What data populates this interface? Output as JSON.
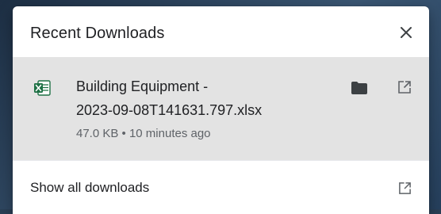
{
  "header": {
    "title": "Recent Downloads",
    "close_icon": "close-icon"
  },
  "downloads": [
    {
      "file_icon": "excel-file-icon",
      "file_name_line1": "Building Equipment -",
      "file_name_line2": "2023-09-08T141631.797.xlsx",
      "meta": "47.0 KB • 10 minutes ago",
      "folder_icon": "folder-icon",
      "open_icon": "open-external-icon"
    }
  ],
  "footer": {
    "label": "Show all downloads",
    "icon": "open-external-icon"
  },
  "colors": {
    "item_background": "#e3e3e3",
    "excel_green": "#1e7145",
    "icon_gray": "#5f6368"
  }
}
